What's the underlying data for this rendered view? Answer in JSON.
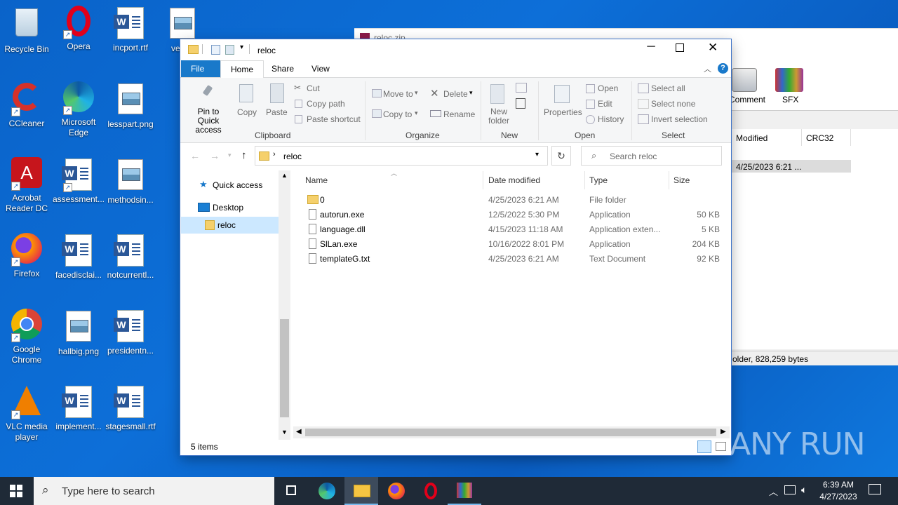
{
  "desktop": {
    "icons": [
      {
        "label": "Recycle Bin"
      },
      {
        "label": "Opera"
      },
      {
        "label": "incport.rtf"
      },
      {
        "label": "versio"
      },
      {
        "label": "CCleaner"
      },
      {
        "label": "Microsoft Edge"
      },
      {
        "label": "lesspart.png"
      },
      {
        "label": "Acrobat Reader DC"
      },
      {
        "label": "assessment..."
      },
      {
        "label": "methodsin..."
      },
      {
        "label": "Firefox"
      },
      {
        "label": "facedisclai..."
      },
      {
        "label": "notcurrentl..."
      },
      {
        "label": "Google Chrome"
      },
      {
        "label": "hallbig.png"
      },
      {
        "label": "presidentn..."
      },
      {
        "label": "VLC media player"
      },
      {
        "label": "implement..."
      },
      {
        "label": "stagesmall.rtf"
      }
    ]
  },
  "winrar": {
    "title": "reloc.zip",
    "toolbar": {
      "comment": "Comment",
      "sfx": "SFX"
    },
    "columns": {
      "modified": "Modified",
      "crc": "CRC32"
    },
    "row_modified": "4/25/2023 6:21 ...",
    "status": "older, 828,259 bytes"
  },
  "explorer": {
    "title": "reloc",
    "tabs": {
      "file": "File",
      "home": "Home",
      "share": "Share",
      "view": "View"
    },
    "ribbon": {
      "pin": "Pin to Quick access",
      "copy": "Copy",
      "paste": "Paste",
      "cut": "Cut",
      "copy_path": "Copy path",
      "paste_shortcut": "Paste shortcut",
      "clipboard": "Clipboard",
      "move_to": "Move to",
      "copy_to": "Copy to",
      "delete": "Delete",
      "rename": "Rename",
      "organize": "Organize",
      "new_folder": "New folder",
      "new": "New",
      "properties": "Properties",
      "open": "Open",
      "edit": "Edit",
      "history": "History",
      "open_group": "Open",
      "select_all": "Select all",
      "select_none": "Select none",
      "invert_selection": "Invert selection",
      "select_group": "Select"
    },
    "address": {
      "path": "reloc",
      "search_placeholder": "Search reloc"
    },
    "nav": {
      "quick_access": "Quick access",
      "desktop": "Desktop",
      "reloc": "reloc"
    },
    "columns": {
      "name": "Name",
      "date": "Date modified",
      "type": "Type",
      "size": "Size"
    },
    "files": [
      {
        "name": "0",
        "date": "4/25/2023 6:21 AM",
        "type": "File folder",
        "size": ""
      },
      {
        "name": "autorun.exe",
        "date": "12/5/2022 5:30 PM",
        "type": "Application",
        "size": "50 KB"
      },
      {
        "name": "language.dll",
        "date": "4/15/2023 11:18 AM",
        "type": "Application exten...",
        "size": "5 KB"
      },
      {
        "name": "SlLan.exe",
        "date": "10/16/2022 8:01 PM",
        "type": "Application",
        "size": "204 KB"
      },
      {
        "name": "templateG.txt",
        "date": "4/25/2023 6:21 AM",
        "type": "Text Document",
        "size": "92 KB"
      }
    ],
    "status": "5 items"
  },
  "taskbar": {
    "search_placeholder": "Type here to search",
    "time": "6:39 AM",
    "date": "4/27/2023"
  },
  "watermark": "ANY RUN"
}
